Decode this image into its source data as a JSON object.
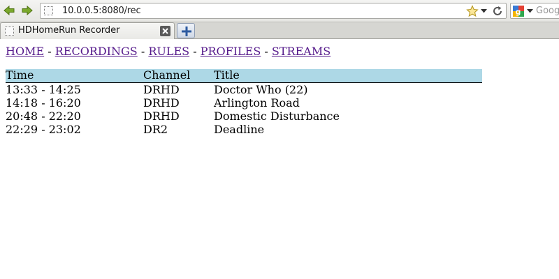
{
  "browser": {
    "url": "10.0.0.5:8080/rec",
    "search_placeholder": "Goog",
    "tab_title": "HDHomeRun Recorder"
  },
  "nav": {
    "links": [
      "HOME",
      "RECORDINGS",
      "RULES",
      "PROFILES",
      "STREAMS"
    ],
    "separator": " - "
  },
  "recordings": {
    "headers": [
      "Time",
      "Channel",
      "Title"
    ],
    "rows": [
      {
        "time": "13:33 - 14:25",
        "channel": "DRHD",
        "title": "Doctor Who (22)"
      },
      {
        "time": "14:18 - 16:20",
        "channel": "DRHD",
        "title": "Arlington Road"
      },
      {
        "time": "20:48 - 22:20",
        "channel": "DRHD",
        "title": "Domestic Disturbance"
      },
      {
        "time": "22:29 - 23:02",
        "channel": "DR2",
        "title": "Deadline"
      }
    ]
  },
  "colors": {
    "header_bg": "#add8e6",
    "link": "#551a8b",
    "nav_arrow": "#6a9a1e"
  },
  "icons": {
    "back": "back-arrow-icon",
    "forward": "forward-arrow-icon",
    "page": "page-icon",
    "bookmark": "star-icon",
    "reload": "reload-icon",
    "search_engine": "google-icon",
    "close_tab": "close-icon",
    "new_tab": "plus-icon"
  }
}
